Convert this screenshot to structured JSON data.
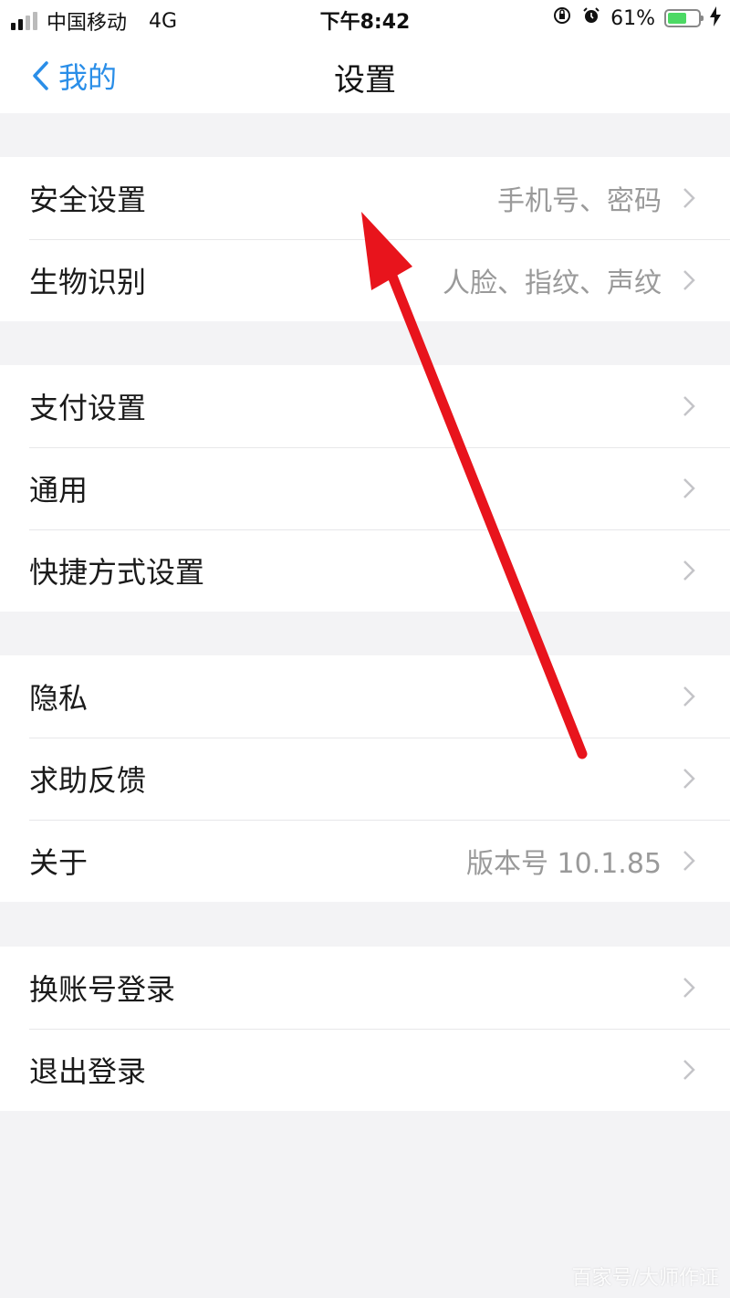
{
  "status_bar": {
    "carrier": "中国移动",
    "network": "4G",
    "time": "下午8:42",
    "battery_percent": "61%",
    "battery_level": 0.61,
    "icons": [
      "signal-icon",
      "orientation-lock-icon",
      "alarm-icon",
      "battery-icon",
      "charging-bolt-icon"
    ]
  },
  "nav": {
    "back_label": "我的",
    "title": "设置"
  },
  "sections": [
    {
      "items": [
        {
          "label": "安全设置",
          "detail": "手机号、密码"
        },
        {
          "label": "生物识别",
          "detail": "人脸、指纹、声纹"
        }
      ]
    },
    {
      "items": [
        {
          "label": "支付设置",
          "detail": ""
        },
        {
          "label": "通用",
          "detail": ""
        },
        {
          "label": "快捷方式设置",
          "detail": ""
        }
      ]
    },
    {
      "items": [
        {
          "label": "隐私",
          "detail": ""
        },
        {
          "label": "求助反馈",
          "detail": ""
        },
        {
          "label": "关于",
          "detail": "版本号 10.1.85"
        }
      ]
    },
    {
      "items": [
        {
          "label": "换账号登录",
          "detail": ""
        },
        {
          "label": "退出登录",
          "detail": ""
        }
      ]
    }
  ],
  "annotation": {
    "arrow_color": "#e8141c"
  },
  "watermark": "百家号/大师作证",
  "colors": {
    "accent": "#2a8ee8",
    "background": "#f3f3f5",
    "detail_text": "#9a9a9a"
  }
}
